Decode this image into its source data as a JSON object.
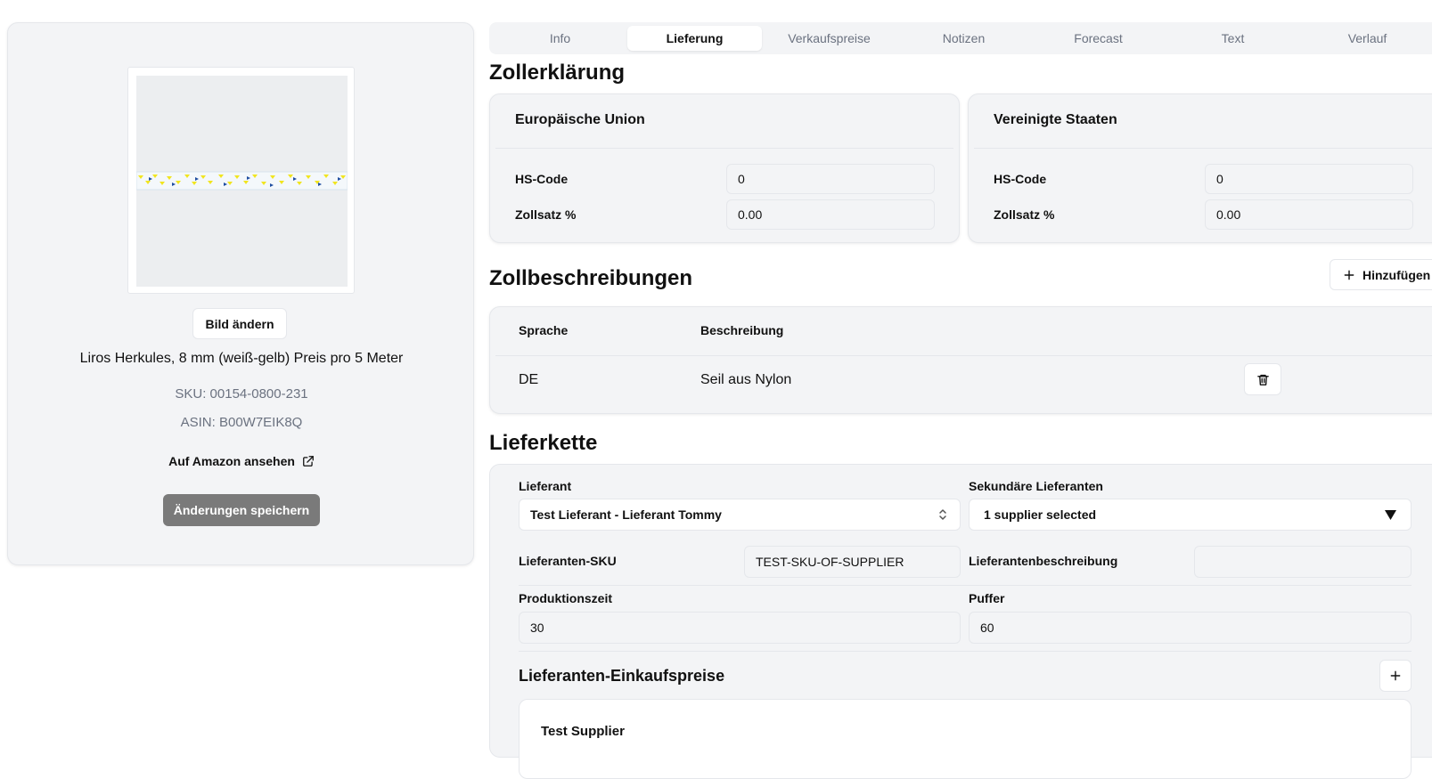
{
  "product": {
    "change_image_label": "Bild ändern",
    "title": "Liros Herkules, 8 mm (weiß-gelb) Preis pro 5 Meter",
    "sku": "SKU: 00154-0800-231",
    "asin": "ASIN: B00W7EIK8Q",
    "amazon_link": "Auf Amazon ansehen",
    "save_label": "Änderungen speichern"
  },
  "tabs": [
    {
      "label": "Info",
      "active": false
    },
    {
      "label": "Lieferung",
      "active": true
    },
    {
      "label": "Verkaufspreise",
      "active": false
    },
    {
      "label": "Notizen",
      "active": false
    },
    {
      "label": "Forecast",
      "active": false
    },
    {
      "label": "Text",
      "active": false
    },
    {
      "label": "Verlauf",
      "active": false
    }
  ],
  "customs": {
    "heading": "Zollerklärung",
    "eu": {
      "title": "Europäische Union",
      "hs_label": "HS-Code",
      "hs_value": "0",
      "rate_label": "Zollsatz %",
      "rate_value": "0.00"
    },
    "us": {
      "title": "Vereinigte Staaten",
      "hs_label": "HS-Code",
      "hs_value": "0",
      "rate_label": "Zollsatz %",
      "rate_value": "0.00"
    }
  },
  "descriptions": {
    "heading": "Zollbeschreibungen",
    "add_label": "Hinzufügen",
    "col_language": "Sprache",
    "col_description": "Beschreibung",
    "rows": [
      {
        "language": "DE",
        "description": "Seil aus Nylon"
      }
    ]
  },
  "supply": {
    "heading": "Lieferkette",
    "supplier_label": "Lieferant",
    "supplier_value": "Test Lieferant - Lieferant Tommy",
    "secondary_label": "Sekundäre Lieferanten",
    "secondary_value": "1 supplier selected",
    "supplier_sku_label": "Lieferanten-SKU",
    "supplier_sku_value": "TEST-SKU-OF-SUPPLIER",
    "supplier_desc_label": "Lieferantenbeschreibung",
    "supplier_desc_value": "",
    "production_label": "Produktionszeit",
    "production_value": "30",
    "buffer_label": "Puffer",
    "buffer_value": "60",
    "purchase_prices_label": "Lieferanten-Einkaufspreise",
    "inner_supplier_name": "Test Supplier"
  }
}
